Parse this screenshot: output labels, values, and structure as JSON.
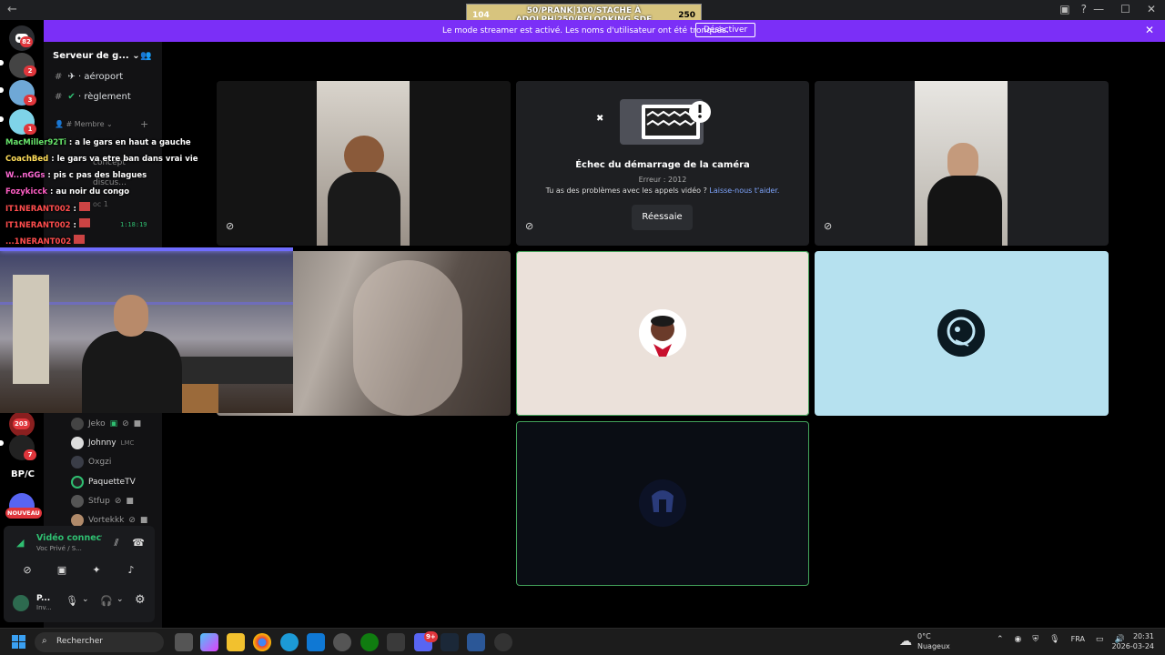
{
  "stream_goal": {
    "left_value": "104",
    "center_line1": "50/PRANK|100/STACHE À",
    "center_line2": "ADOLPH|250/RELOOKING SDF",
    "right_value": "250"
  },
  "banner": {
    "message": "Le mode streamer est activé. Les noms d'utilisateur ont été tronqués.",
    "button": "Désactiver"
  },
  "rail": {
    "badges": [
      "82",
      "2",
      "3",
      "1",
      "203",
      "7"
    ],
    "bpc_label": "BP/C",
    "new_label": "NOUVEAU"
  },
  "sidebar": {
    "server_name": "Serveur de g...",
    "channels": [
      {
        "name": "aéroport"
      },
      {
        "name": "règlement"
      }
    ],
    "category": "Membre",
    "partial_channels": [
      "concept",
      "discus...",
      "oc 1"
    ],
    "timer": "1:18:19"
  },
  "chat": [
    {
      "user": "MacMiller92Ti",
      "msg": "a le gars en haut a gauche",
      "color": "#66e36a"
    },
    {
      "user": "CoachBed",
      "msg": "le gars va etre ban dans vrai vie",
      "color": "#ffde59"
    },
    {
      "user": "W...nGGs",
      "msg": "pis c pas des blagues",
      "color": "#ff6ad5"
    },
    {
      "user": "Fozykicck",
      "msg": "au noir du congo",
      "color": "#ff5ec4"
    },
    {
      "user": "IT1NERANT002",
      "msg": "",
      "color": "#ff4d4d"
    },
    {
      "user": "IT1NERANT002",
      "msg": "",
      "color": "#ff4d4d"
    },
    {
      "user": "...1NERANT002",
      "msg": "",
      "color": "#ff4d4d"
    }
  ],
  "camera_error": {
    "title": "Échec du démarrage de la caméra",
    "code": "Erreur : 2012",
    "help_text": "Tu as des problèmes avec les appels vidéo ?",
    "help_link": "Laisse-nous t'aider.",
    "retry": "Réessaie"
  },
  "members": [
    {
      "name": "Jeko",
      "online": false
    },
    {
      "name": "Johnny",
      "online": true,
      "tag": "LMC"
    },
    {
      "name": "Oxgzi",
      "online": false
    },
    {
      "name": "PaquetteTV",
      "online": true
    },
    {
      "name": "Stfup",
      "online": false
    },
    {
      "name": "Vortekkk",
      "online": false
    }
  ],
  "voice": {
    "status": "Vidéo connectée",
    "room": "Voc Privé / S...",
    "user_name": "P...",
    "user_status": "Inv..."
  },
  "taskbar": {
    "search": "Rechercher",
    "weather_temp": "0°C",
    "weather_desc": "Nuageux",
    "lang": "FRA",
    "time": "20:31",
    "date": "2026-03-24",
    "discord_badge": "9+"
  },
  "colors": {
    "accent": "#7b2ff7",
    "speaking": "#43a25a",
    "connected": "#2fbf71",
    "badge": "#e0363c"
  }
}
